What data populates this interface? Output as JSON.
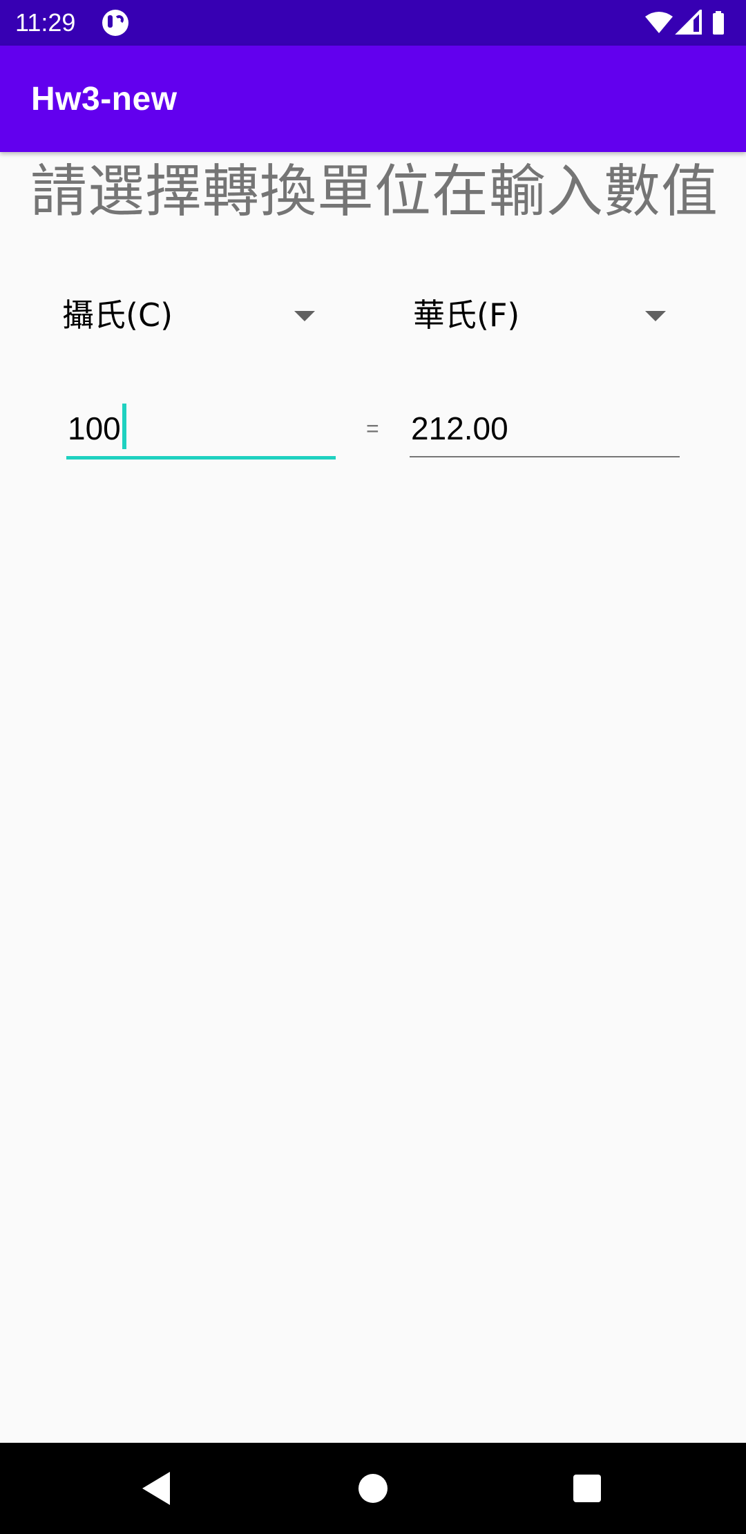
{
  "status_bar": {
    "time": "11:29",
    "icons": [
      "app-notification-icon",
      "wifi-icon",
      "signal-icon",
      "battery-icon"
    ]
  },
  "app_bar": {
    "title": "Hw3-new",
    "color": "#6200ee"
  },
  "main": {
    "heading": "請選擇轉換單位在輸入數值",
    "from_unit": {
      "selected": "攝氏(C)"
    },
    "to_unit": {
      "selected": "華氏(F)"
    },
    "input_value": "100",
    "equals_sign": "=",
    "result_value": "212.00",
    "accent_color": "#1fd1c0"
  },
  "nav_bar": {
    "buttons": [
      "back-icon",
      "home-icon",
      "recents-icon"
    ]
  }
}
